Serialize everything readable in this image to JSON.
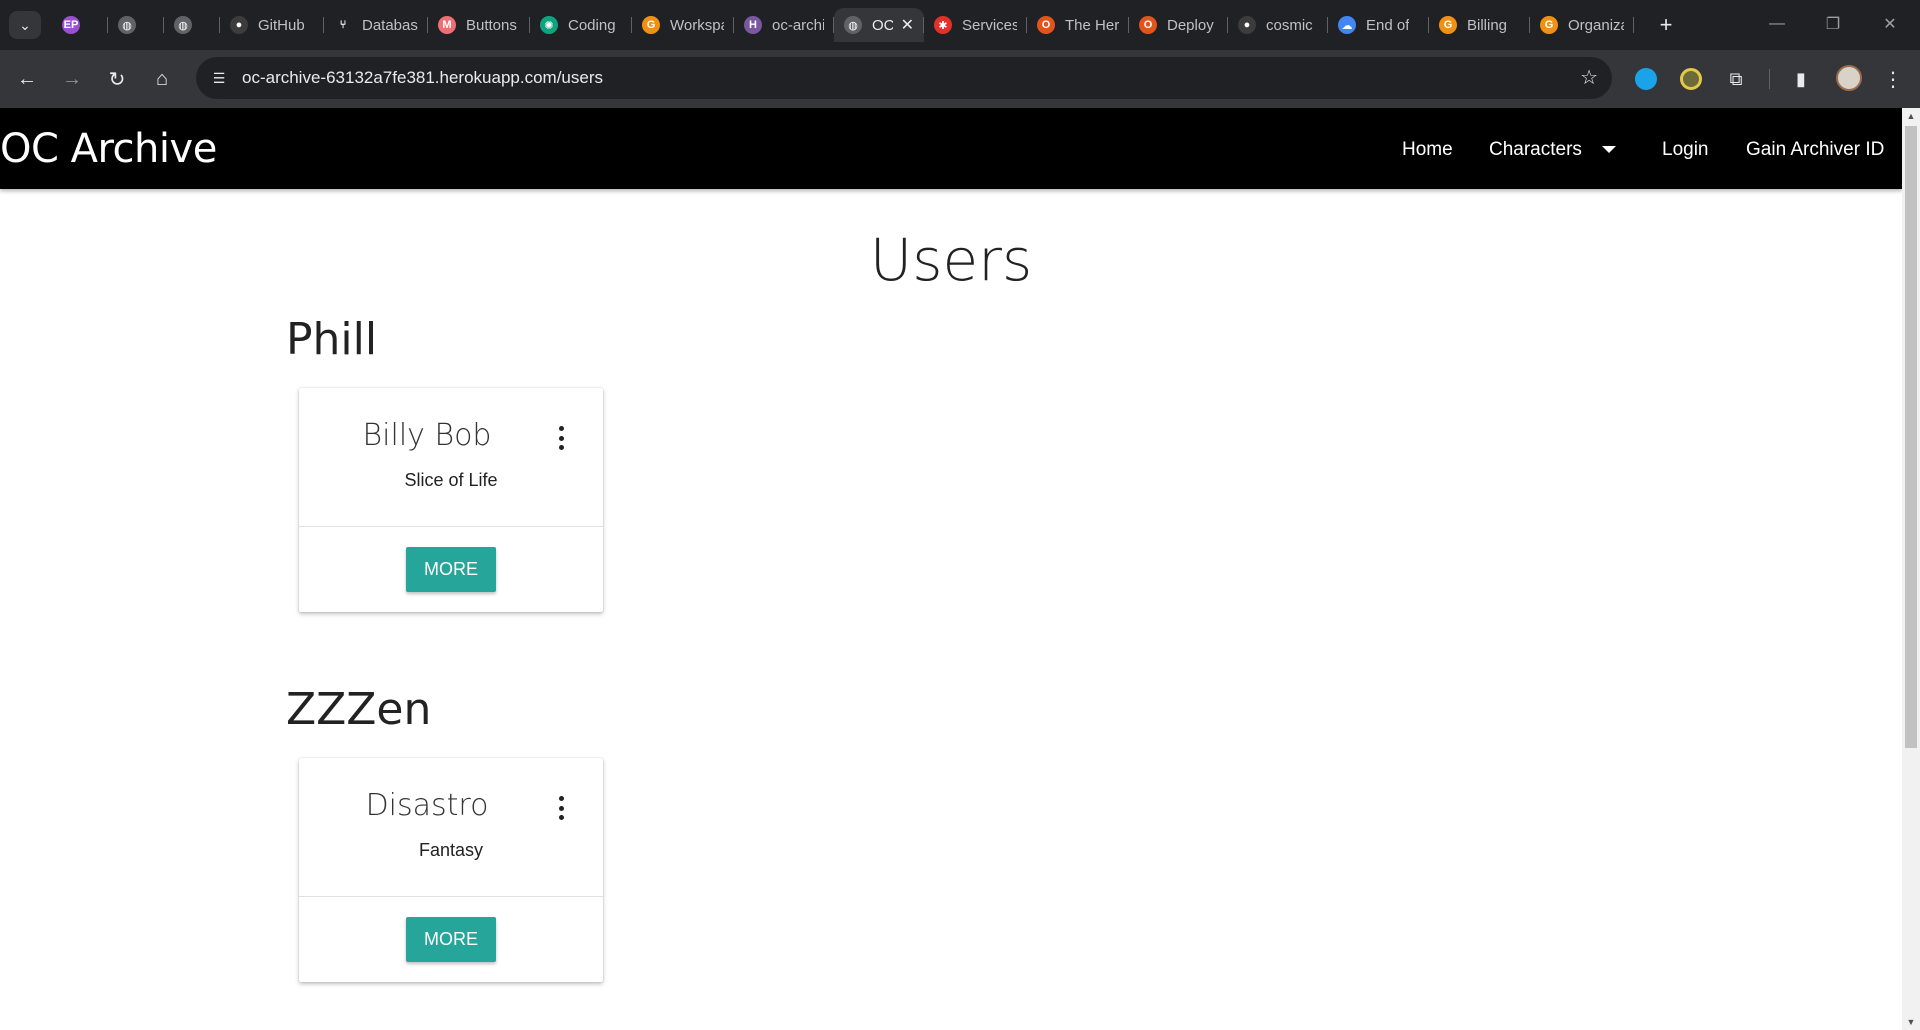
{
  "browser": {
    "tabs": [
      {
        "label": "",
        "favicon": "ep-badge-icon",
        "color": "#9c4fcf",
        "glyph": "EP"
      },
      {
        "label": "",
        "favicon": "globe-icon",
        "color": "#5f6368",
        "glyph": "◍"
      },
      {
        "label": "",
        "favicon": "globe-icon",
        "color": "#5f6368",
        "glyph": "◍"
      },
      {
        "label": "GitHub",
        "favicon": "github-icon",
        "color": "#3c3c3c",
        "glyph": "●"
      },
      {
        "label": "Database",
        "favicon": "git-branch-icon",
        "color": "#202124",
        "glyph": "⑂"
      },
      {
        "label": "Buttons",
        "favicon": "materialize-icon",
        "color": "#ee6e73",
        "glyph": "M"
      },
      {
        "label": "Coding",
        "favicon": "openai-icon",
        "color": "#10a37f",
        "glyph": "✺"
      },
      {
        "label": "Workspace",
        "favicon": "g-orange-icon",
        "color": "#f29111",
        "glyph": "G"
      },
      {
        "label": "oc-archive",
        "favicon": "heroku-icon",
        "color": "#79589f",
        "glyph": "H"
      },
      {
        "label": "OC Archive",
        "favicon": "globe-icon",
        "color": "#5f6368",
        "glyph": "◍",
        "active": true
      },
      {
        "label": "Services",
        "favicon": "crab-icon",
        "color": "#e0312b",
        "glyph": "✱"
      },
      {
        "label": "The Heroku",
        "favicon": "o-ring-icon",
        "color": "#e2541c",
        "glyph": "O"
      },
      {
        "label": "Deploy",
        "favicon": "o-ring-icon",
        "color": "#e2541c",
        "glyph": "O"
      },
      {
        "label": "cosmic",
        "favicon": "github-icon",
        "color": "#3c3c3c",
        "glyph": "●"
      },
      {
        "label": "End of",
        "favicon": "cloud-icon",
        "color": "#4285f4",
        "glyph": "☁"
      },
      {
        "label": "Billing",
        "favicon": "g-orange-icon",
        "color": "#f29111",
        "glyph": "G"
      },
      {
        "label": "Organizations",
        "favicon": "g-orange-icon",
        "color": "#f29111",
        "glyph": "G"
      }
    ],
    "close_glyph": "✕",
    "url": "oc-archive-63132a7fe381.herokuapp.com/users"
  },
  "navbar": {
    "brand": "OC Archive",
    "links": {
      "home": "Home",
      "characters": "Characters",
      "login": "Login",
      "gain_id": "Gain Archiver ID"
    }
  },
  "page": {
    "title": "Users",
    "users": [
      {
        "name": "Phill",
        "character": {
          "name": "Billy Bob",
          "genre": "Slice of Life",
          "button": "MORE"
        }
      },
      {
        "name": "ZZZen",
        "character": {
          "name": "Disastro",
          "genre": "Fantasy",
          "button": "MORE"
        }
      }
    ]
  },
  "colors": {
    "accent_teal": "#26a69a",
    "navbar_bg": "#000000",
    "chrome_dark": "#202124"
  }
}
